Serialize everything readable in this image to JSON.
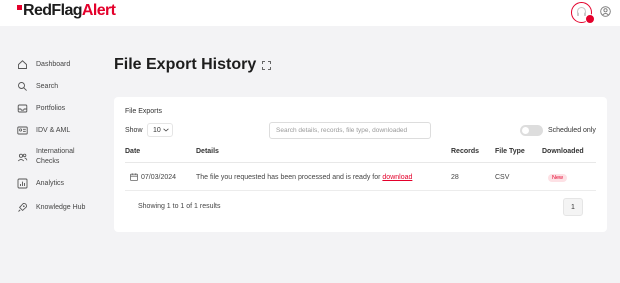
{
  "brand": {
    "part1": "RedFlag",
    "part2": "Alert",
    "accent": "#e4002b"
  },
  "header": {
    "notification_icon": "headset-icon",
    "user_icon": "user-icon"
  },
  "sidebar": {
    "items": [
      {
        "label": "Dashboard",
        "icon": "home-icon"
      },
      {
        "label": "Search",
        "icon": "search-icon"
      },
      {
        "label": "Portfolios",
        "icon": "inbox-icon"
      },
      {
        "label": "IDV & AML",
        "icon": "id-card-icon"
      },
      {
        "label": "International",
        "label2": "Checks",
        "icon": "people-icon"
      },
      {
        "label": "Analytics",
        "icon": "chart-icon"
      },
      {
        "label": "Knowledge Hub",
        "icon": "rocket-icon"
      }
    ]
  },
  "page": {
    "title": "File Export History"
  },
  "card": {
    "title": "File Exports",
    "show_label": "Show",
    "show_value": "10",
    "search_placeholder": "Search details, records, file type, downloaded",
    "toggle_label": "Scheduled only",
    "toggle_on": false,
    "columns": [
      "Date",
      "Details",
      "Records",
      "File Type",
      "Downloaded"
    ],
    "rows": [
      {
        "date": "07/03/2024",
        "details": "The file you requested has been processed and is ready for",
        "link": "download",
        "records": "28",
        "file_type": "CSV",
        "status": "New"
      }
    ],
    "footer": "Showing 1 to 1 of 1 results",
    "page": "1"
  }
}
